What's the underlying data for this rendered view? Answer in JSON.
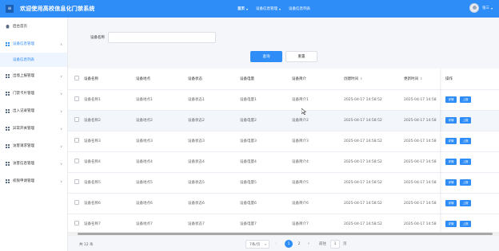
{
  "header": {
    "menu_icon": "menu-icon",
    "title": "欢迎使用高校信息化门禁系统",
    "nav": [
      {
        "label": "首页",
        "caret": "▾"
      },
      {
        "label": "设备信息管理",
        "caret": "▾"
      },
      {
        "label": "设备信息列表",
        "caret": ""
      }
    ],
    "user_name": "张三",
    "user_caret": "▾",
    "color": "#2f8df7"
  },
  "sidebar": {
    "items": [
      {
        "label": "后台首页",
        "icon": "home-icon"
      },
      {
        "label": "设备信息管理",
        "icon": "grid-icon",
        "chevron": "∧"
      },
      {
        "label": "设备信息列表",
        "sub": true
      },
      {
        "label": "出境上报管理",
        "icon": "grid-icon",
        "chevron": "∨"
      },
      {
        "label": "门禁卡片管理",
        "icon": "grid-icon",
        "chevron": "∨"
      },
      {
        "label": "出入记录管理",
        "icon": "grid-icon",
        "chevron": "∨"
      },
      {
        "label": "异常开关管理",
        "icon": "grid-icon",
        "chevron": "∨"
      },
      {
        "label": "访客请求管理",
        "icon": "grid-icon",
        "chevron": "∨"
      },
      {
        "label": "访客信息管理",
        "icon": "grid-icon",
        "chevron": "∨"
      },
      {
        "label": "权限申请管理",
        "icon": "grid-icon",
        "chevron": "∨"
      }
    ]
  },
  "search": {
    "label": "设备名称",
    "value": "",
    "placeholder": "",
    "search_button": "查询",
    "reset_button": "重置"
  },
  "table": {
    "columns": [
      "设备名称",
      "设备地点",
      "设备状态",
      "设备电量",
      "设备简介",
      "创建时间",
      "更新时间",
      "操作"
    ],
    "sort_icon": "⇕",
    "rows": [
      [
        "设备名称1",
        "设备地点1",
        "设备状态1",
        "设备电量1",
        "设备简介1",
        "2025-04-17 14:58:52",
        "2025-04-17 14:58"
      ],
      [
        "设备名称2",
        "设备地点2",
        "设备状态2",
        "设备电量2",
        "设备简介2",
        "2025-04-17 14:58:52",
        "2025-04-17 14:58"
      ],
      [
        "设备名称3",
        "设备地点3",
        "设备状态3",
        "设备电量3",
        "设备简介3",
        "2025-04-17 14:58:52",
        "2025-04-17 14:58"
      ],
      [
        "设备名称4",
        "设备地点4",
        "设备状态4",
        "设备电量4",
        "设备简介4",
        "2025-04-17 14:58:52",
        "2025-04-17 14:58"
      ],
      [
        "设备名称5",
        "设备地点5",
        "设备状态5",
        "设备电量5",
        "设备简介5",
        "2025-04-17 14:58:52",
        "2025-04-17 14:58"
      ],
      [
        "设备名称6",
        "设备地点6",
        "设备状态6",
        "设备电量6",
        "设备简介6",
        "2025-04-17 14:58:52",
        "2025-04-17 14:58"
      ],
      [
        "设备名称7",
        "设备地点7",
        "设备状态7",
        "设备电量7",
        "设备简介7",
        "2025-04-17 14:58:52",
        "2025-04-17 14:58"
      ]
    ],
    "op_detail": "详情",
    "op_edit": "上报"
  },
  "pager": {
    "total": "共 12 条",
    "page_size": "7条/页",
    "prev": "‹",
    "pages": [
      "1",
      "2"
    ],
    "current": "1",
    "next": "›",
    "goto_label": "前往",
    "goto_value": "1",
    "unit": "页"
  }
}
